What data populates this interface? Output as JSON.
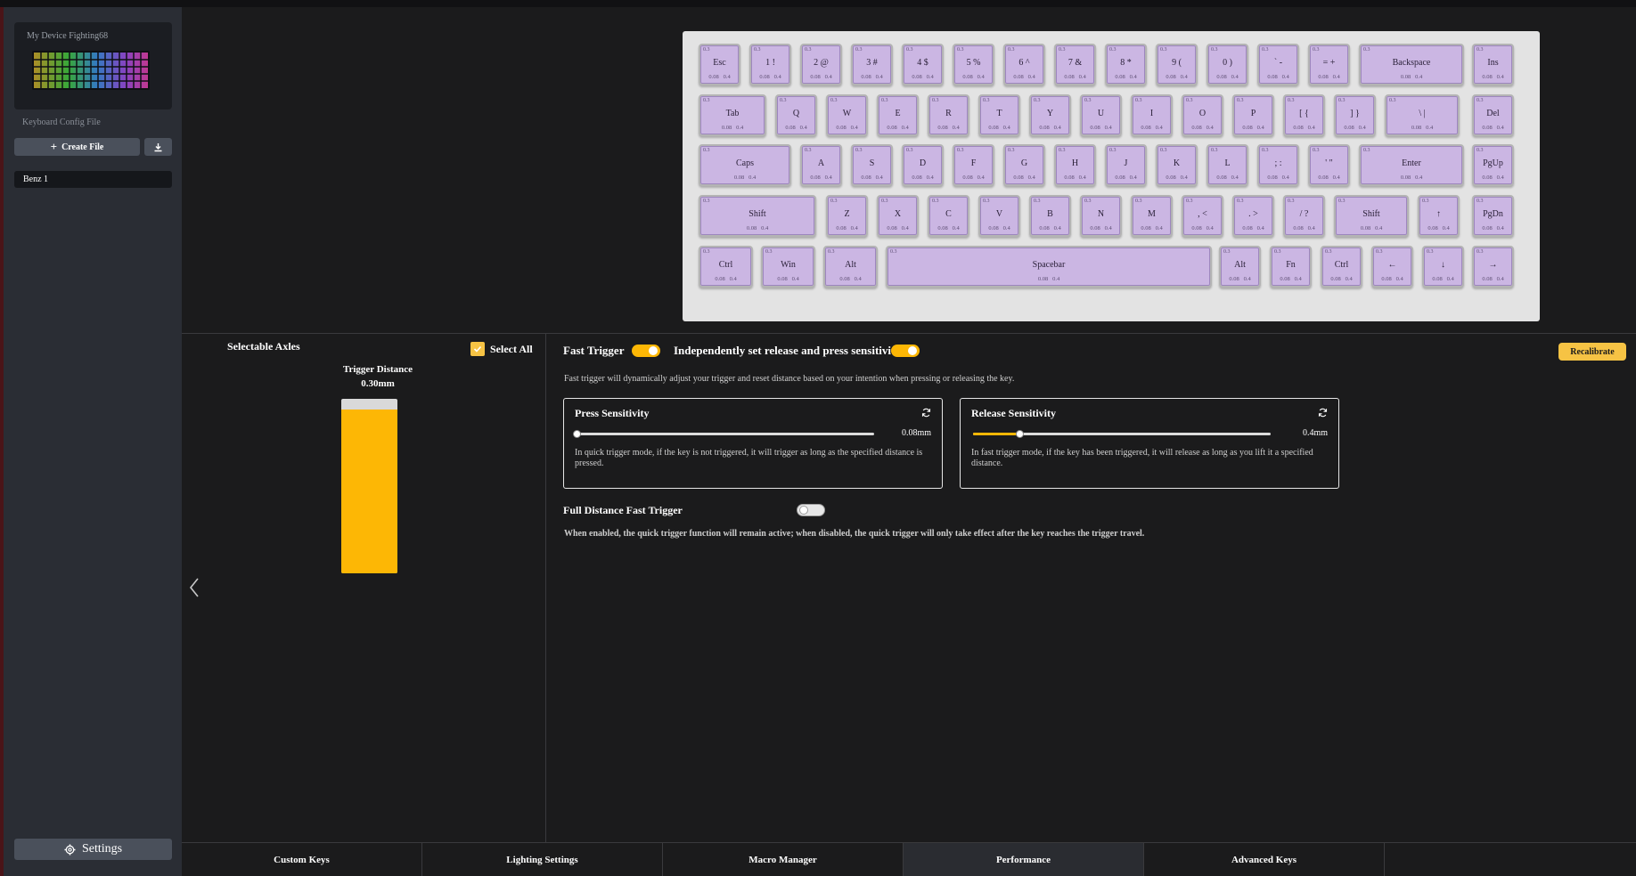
{
  "sidebar": {
    "device_name": "My Device Fighting68",
    "config_label": "Keyboard Config File",
    "create_file_label": "Create File",
    "files": [
      {
        "label": "Benz 1"
      }
    ],
    "settings_label": "Settings"
  },
  "keyboard": {
    "default_trigger": "0.3",
    "default_bottom": "0.08   0.4",
    "rows": [
      [
        {
          "label": "Esc"
        },
        {
          "label": "1 !"
        },
        {
          "label": "2 @"
        },
        {
          "label": "3 #"
        },
        {
          "label": "4 $"
        },
        {
          "label": "5 %"
        },
        {
          "label": "6 ^"
        },
        {
          "label": "7 &"
        },
        {
          "label": "8 *"
        },
        {
          "label": "9 ("
        },
        {
          "label": "0 )"
        },
        {
          "label": "` -"
        },
        {
          "label": "= +"
        },
        {
          "label": "Backspace"
        },
        {
          "label": "Ins"
        }
      ],
      [
        {
          "label": "Tab"
        },
        {
          "label": "Q"
        },
        {
          "label": "W"
        },
        {
          "label": "E"
        },
        {
          "label": "R"
        },
        {
          "label": "T"
        },
        {
          "label": "Y"
        },
        {
          "label": "U"
        },
        {
          "label": "I"
        },
        {
          "label": "O"
        },
        {
          "label": "P"
        },
        {
          "label": "[ {"
        },
        {
          "label": "] }"
        },
        {
          "label": "\\ |"
        },
        {
          "label": "Del"
        }
      ],
      [
        {
          "label": "Caps"
        },
        {
          "label": "A"
        },
        {
          "label": "S"
        },
        {
          "label": "D"
        },
        {
          "label": "F"
        },
        {
          "label": "G"
        },
        {
          "label": "H"
        },
        {
          "label": "J"
        },
        {
          "label": "K"
        },
        {
          "label": "L"
        },
        {
          "label": "; :"
        },
        {
          "label": "' \""
        },
        {
          "label": "Enter"
        },
        {
          "label": "PgUp"
        }
      ],
      [
        {
          "label": "Shift"
        },
        {
          "label": "Z"
        },
        {
          "label": "X"
        },
        {
          "label": "C"
        },
        {
          "label": "V"
        },
        {
          "label": "B"
        },
        {
          "label": "N"
        },
        {
          "label": "M"
        },
        {
          "label": ", <"
        },
        {
          "label": ". >"
        },
        {
          "label": "/ ?"
        },
        {
          "label": "Shift"
        },
        {
          "label": "↑"
        },
        {
          "label": "PgDn"
        }
      ],
      [
        {
          "label": "Ctrl"
        },
        {
          "label": "Win"
        },
        {
          "label": "Alt"
        },
        {
          "label": "Spacebar"
        },
        {
          "label": "Alt"
        },
        {
          "label": "Fn"
        },
        {
          "label": "Ctrl"
        },
        {
          "label": "←"
        },
        {
          "label": "↓"
        },
        {
          "label": "→"
        }
      ]
    ]
  },
  "axles": {
    "title": "Selectable Axles",
    "select_all_label": "Select All",
    "select_all_checked": true,
    "trigger_distance_label": "Trigger Distance",
    "trigger_distance_value": "0.30mm",
    "trigger_fill_fraction": 0.94
  },
  "fast_trigger": {
    "label": "Fast Trigger",
    "enabled": true,
    "independent_label": "Independently set release and press sensitivity",
    "independent_enabled": true,
    "recalibrate_label": "Recalibrate",
    "description": "Fast trigger will dynamically adjust your trigger and reset distance based on your intention when pressing or releasing the key.",
    "press": {
      "title": "Press Sensitivity",
      "value_label": "0.08mm",
      "fraction": 0.0,
      "description": "In quick trigger mode, if the key is not triggered, it will trigger as long as the specified distance is pressed."
    },
    "release": {
      "title": "Release Sensitivity",
      "value_label": "0.4mm",
      "fraction": 0.155,
      "description": "In fast trigger mode, if the key has been triggered, it will release as long as you lift it a specified distance."
    },
    "full_distance": {
      "label": "Full Distance Fast Trigger",
      "enabled": false,
      "description": "When enabled, the quick trigger function will remain active; when disabled, the quick trigger will only take effect after the key reaches the trigger travel."
    }
  },
  "tabs": [
    {
      "label": "Custom Keys",
      "active": false
    },
    {
      "label": "Lighting Settings",
      "active": false
    },
    {
      "label": "Macro Manager",
      "active": false
    },
    {
      "label": "Performance",
      "active": true
    },
    {
      "label": "Advanced Keys",
      "active": false
    }
  ],
  "colors": {
    "accent": "#fdb705",
    "key": "#cbb6e3",
    "panel": "#1b1b1c",
    "sidebar": "#2a2d34"
  }
}
